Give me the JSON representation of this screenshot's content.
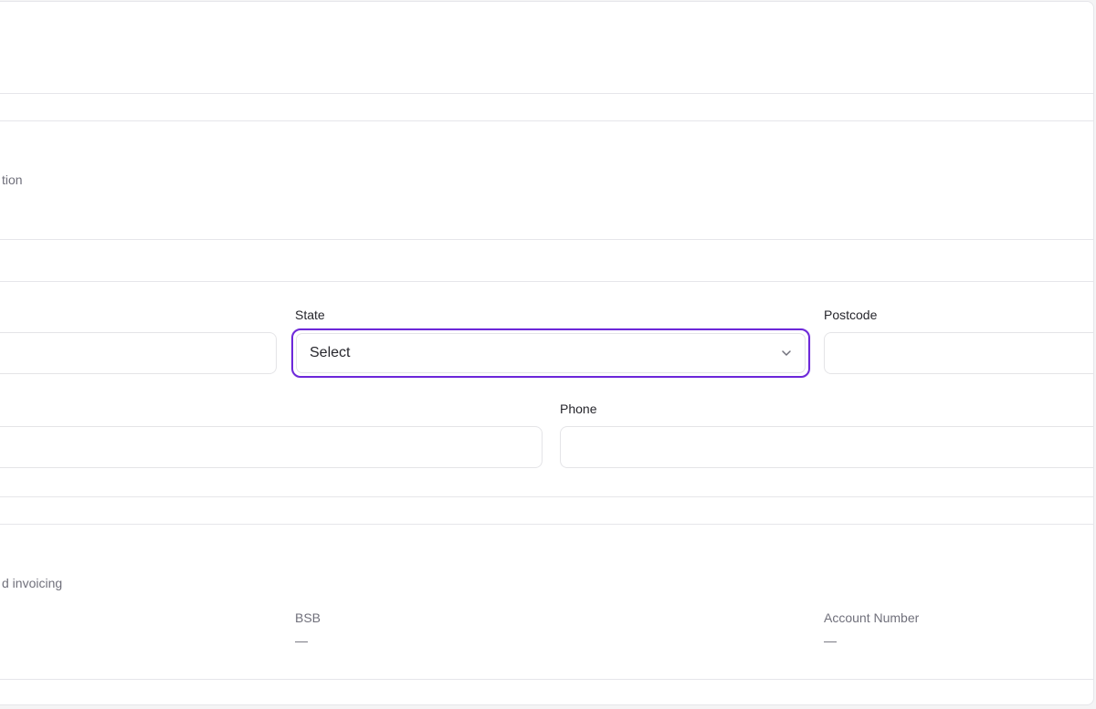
{
  "sections": {
    "contact_section": {
      "description_fragment": "tion"
    },
    "banking_section": {
      "description_fragment": "d invoicing"
    }
  },
  "address": {
    "state": {
      "label": "State",
      "selected": "Select"
    },
    "postcode": {
      "label": "Postcode",
      "value": ""
    },
    "phone": {
      "label": "Phone",
      "value": ""
    }
  },
  "banking": {
    "bsb": {
      "label": "BSB",
      "value": "—"
    },
    "account_number": {
      "label": "Account Number",
      "value": "—"
    }
  },
  "colors": {
    "accent": "#6d28d9",
    "border": "#e4e4e7",
    "muted_text": "#70707b"
  },
  "icons": {
    "select_chevron": "chevron-down-icon"
  }
}
